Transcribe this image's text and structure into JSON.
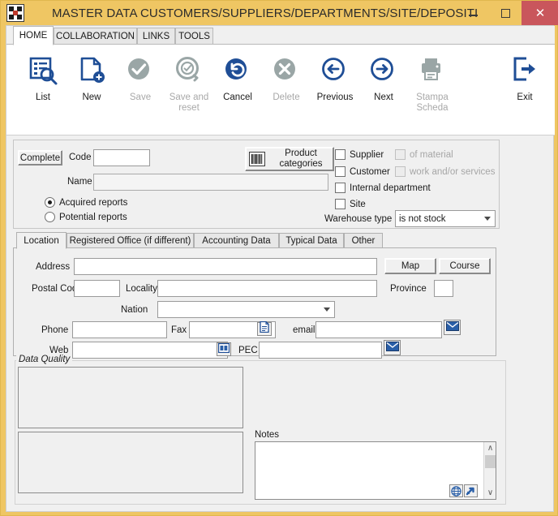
{
  "window": {
    "title": "MASTER DATA CUSTOMERS/SUPPLIERS/DEPARTMENTS/SITE/DEPOSITI",
    "app_icon": "checkered-flag-icon",
    "minimize_label": "–",
    "maximize_label": "□",
    "close_label": "✕",
    "titlebar_color": "#efc663",
    "close_color": "#c9565c"
  },
  "ribbon": {
    "tabs": [
      {
        "label": "HOME",
        "active": true
      },
      {
        "label": "COLLABORATION",
        "active": false
      },
      {
        "label": "LINKS",
        "active": false
      },
      {
        "label": "TOOLS",
        "active": false
      }
    ],
    "buttons": [
      {
        "label": "List",
        "icon": "list-search-icon",
        "enabled": true
      },
      {
        "label": "New",
        "icon": "new-document-icon",
        "enabled": true
      },
      {
        "label": "Save",
        "icon": "check-circle-icon",
        "enabled": false
      },
      {
        "label": "Save and reset",
        "icon": "check-circle-refresh-icon",
        "enabled": false
      },
      {
        "label": "Cancel",
        "icon": "undo-circle-icon",
        "enabled": true
      },
      {
        "label": "Delete",
        "icon": "x-circle-icon",
        "enabled": false
      },
      {
        "label": "Previous",
        "icon": "arrow-left-circle-icon",
        "enabled": true
      },
      {
        "label": "Next",
        "icon": "arrow-right-circle-icon",
        "enabled": true
      },
      {
        "label": "Stampa Scheda",
        "icon": "printer-icon",
        "enabled": false
      },
      {
        "label": "Exit",
        "icon": "exit-arrow-icon",
        "enabled": true
      }
    ],
    "accent_color": "#1f4e96",
    "disabled_color": "#a8a8a8"
  },
  "header_form": {
    "complete_button": "Complete",
    "code_label": "Code",
    "code_value": "",
    "name_label": "Name",
    "name_value": "",
    "product_categories_button": "Product categories",
    "barcode_icon": "barcode-icon",
    "radios": [
      {
        "label": "Acquired reports",
        "selected": true
      },
      {
        "label": "Potential reports",
        "selected": false
      }
    ],
    "checkboxes": [
      {
        "label": "Supplier",
        "checked": false,
        "enabled": true
      },
      {
        "label": "Customer",
        "checked": false,
        "enabled": true
      },
      {
        "label": "Internal department",
        "checked": false,
        "enabled": true
      },
      {
        "label": "Site",
        "checked": false,
        "enabled": true
      },
      {
        "label": "of material",
        "checked": false,
        "enabled": false
      },
      {
        "label": "work and/or services",
        "checked": false,
        "enabled": false
      }
    ],
    "warehouse_type_label": "Warehouse type",
    "warehouse_type_value": "is not stock"
  },
  "location_tabs": [
    {
      "label": "Location",
      "active": true
    },
    {
      "label": "Registered Office (if different)",
      "active": false
    },
    {
      "label": "Accounting Data",
      "active": false
    },
    {
      "label": "Typical Data",
      "active": false
    },
    {
      "label": "Other",
      "active": false
    }
  ],
  "location": {
    "address_label": "Address",
    "address_value": "",
    "map_button": "Map",
    "course_button": "Course",
    "postal_code_label": "Postal Code",
    "postal_code_value": "",
    "locality_label": "Locality",
    "locality_value": "",
    "province_label": "Province",
    "province_value": "",
    "nation_label": "Nation",
    "nation_value": "",
    "phone_label": "Phone",
    "phone_value": "",
    "fax_label": "Fax",
    "fax_value": "",
    "fax_icon": "document-icon",
    "email_label": "email",
    "email_value": "",
    "email_icon": "envelope-icon",
    "web_label": "Web",
    "web_value": "",
    "web_icon": "browser-icon",
    "pec_label": "PEC",
    "pec_value": "",
    "pec_icon": "envelope-icon"
  },
  "data_quality": {
    "legend": "Data Quality",
    "box_top_value": "",
    "box_bottom_value": ""
  },
  "notes": {
    "label": "Notes",
    "value": "",
    "globe_icon": "globe-icon",
    "open-external_icon": "open-external-icon",
    "scroll_up": "∧",
    "scroll_down": "∨"
  }
}
